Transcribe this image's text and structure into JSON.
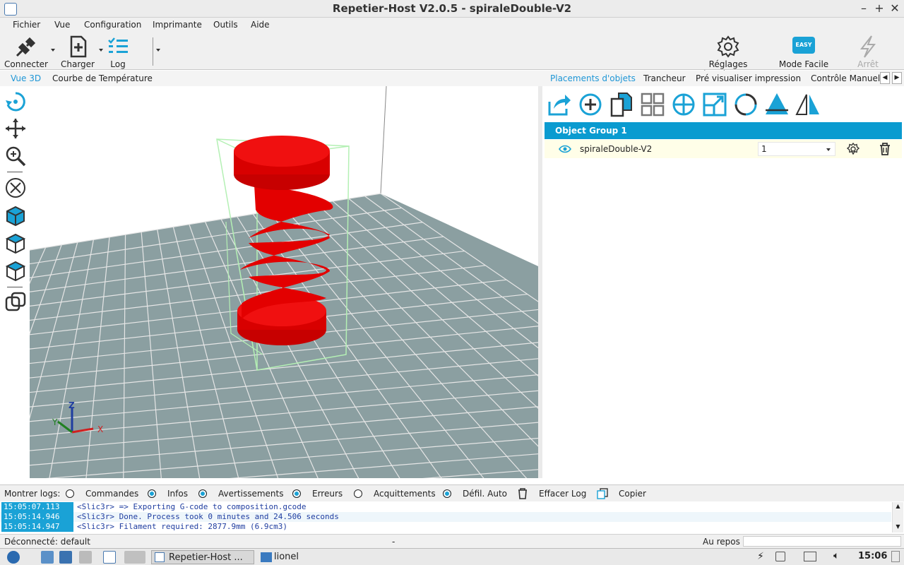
{
  "window": {
    "title": "Repetier-Host V2.0.5 - spiraleDouble-V2"
  },
  "menu": [
    "Fichier",
    "Vue",
    "Configuration",
    "Imprimante",
    "Outils",
    "Aide"
  ],
  "toolbar": {
    "connect": "Connecter",
    "load": "Charger",
    "log": "Log",
    "printer_settings": "Réglages imprimante",
    "easy_mode": "Mode Facile",
    "easy_badge": "EASY",
    "emergency_stop": "Arrêt d'Urgence"
  },
  "left_tabs": [
    "Vue 3D",
    "Courbe de Température"
  ],
  "right_tabs": [
    "Placements d'objets",
    "Trancheur",
    "Pré visualiser impression",
    "Contrôle Manuel"
  ],
  "axes": {
    "x": "X",
    "y": "Y",
    "z": "Z"
  },
  "objects": {
    "group_name": "Object Group 1",
    "items": [
      {
        "name": "spiraleDouble-V2",
        "copies": "1"
      }
    ]
  },
  "log_bar": {
    "label": "Montrer logs:",
    "commands": "Commandes",
    "infos": "Infos",
    "warnings": "Avertissements",
    "errors": "Erreurs",
    "acks": "Acquittements",
    "autoscroll": "Défil. Auto",
    "clear": "Effacer Log",
    "copy": "Copier"
  },
  "log": [
    {
      "time": "15:05:07.113",
      "msg": "<Slic3r> => Exporting G-code to composition.gcode"
    },
    {
      "time": "15:05:14.946",
      "msg": "<Slic3r> Done. Process took 0 minutes and 24.506 seconds"
    },
    {
      "time": "15:05:14.947",
      "msg": "<Slic3r> Filament required: 2877.9mm (6.9cm3)"
    }
  ],
  "status": {
    "connection": "Déconnecté: default",
    "dash": "-",
    "state": "Au repos"
  },
  "taskbar": {
    "app": "Repetier-Host ...",
    "folder": "lionel",
    "clock": "15:06"
  },
  "colors": {
    "accent": "#1aa2d6",
    "group_header": "#0a9bd0",
    "object": "#e00000",
    "bed": "#8b9fa1"
  }
}
